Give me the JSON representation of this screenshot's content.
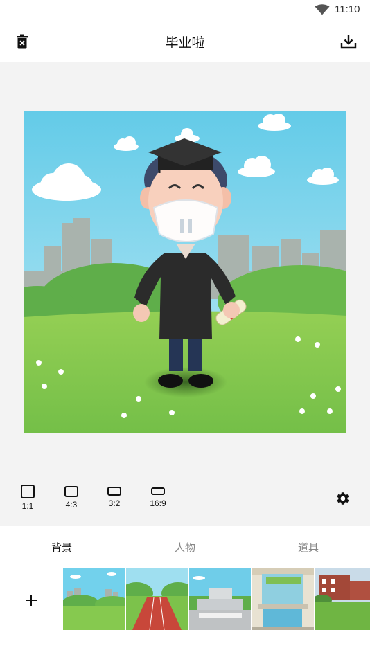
{
  "status_bar": {
    "time": "11:10"
  },
  "app_bar": {
    "title": "毕业啦",
    "left_icon": "delete-icon",
    "right_icon": "download-icon"
  },
  "aspect_ratios": [
    {
      "label": "1:1"
    },
    {
      "label": "4:3"
    },
    {
      "label": "3:2"
    },
    {
      "label": "16:9"
    }
  ],
  "tabs": [
    {
      "label": "背景",
      "active": true
    },
    {
      "label": "人物",
      "active": false
    },
    {
      "label": "道具",
      "active": false
    }
  ],
  "thumbnails": [
    {
      "name": "green-field-city"
    },
    {
      "name": "running-track"
    },
    {
      "name": "school-building"
    },
    {
      "name": "glass-building-garden"
    },
    {
      "name": "campus-lawn"
    }
  ],
  "colors": {
    "accent": "#111111",
    "inactive_tab": "#888888",
    "canvas_bg": "#f3f3f3",
    "sky": "#6fd0ec",
    "grass": "#7cc54a"
  }
}
